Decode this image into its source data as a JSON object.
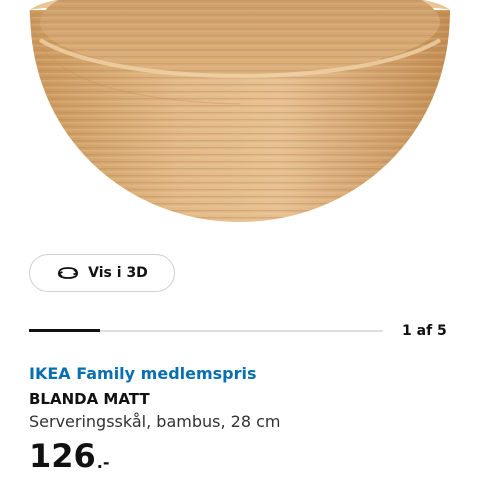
{
  "view3d": {
    "label": "Vis i 3D",
    "icon": "rotate-3d-icon"
  },
  "gallery": {
    "page_indicator": "1 af 5",
    "current": 1,
    "total": 5
  },
  "product": {
    "family_price_label": "IKEA Family medlemspris",
    "name": "BLANDA MATT",
    "description": "Serveringsskål, bambus, 28 cm",
    "price_main": "126",
    "price_suffix": ".-"
  },
  "colors": {
    "family_blue": "#0a6fb0",
    "bamboo": "#d9ad76",
    "text": "#111111"
  }
}
